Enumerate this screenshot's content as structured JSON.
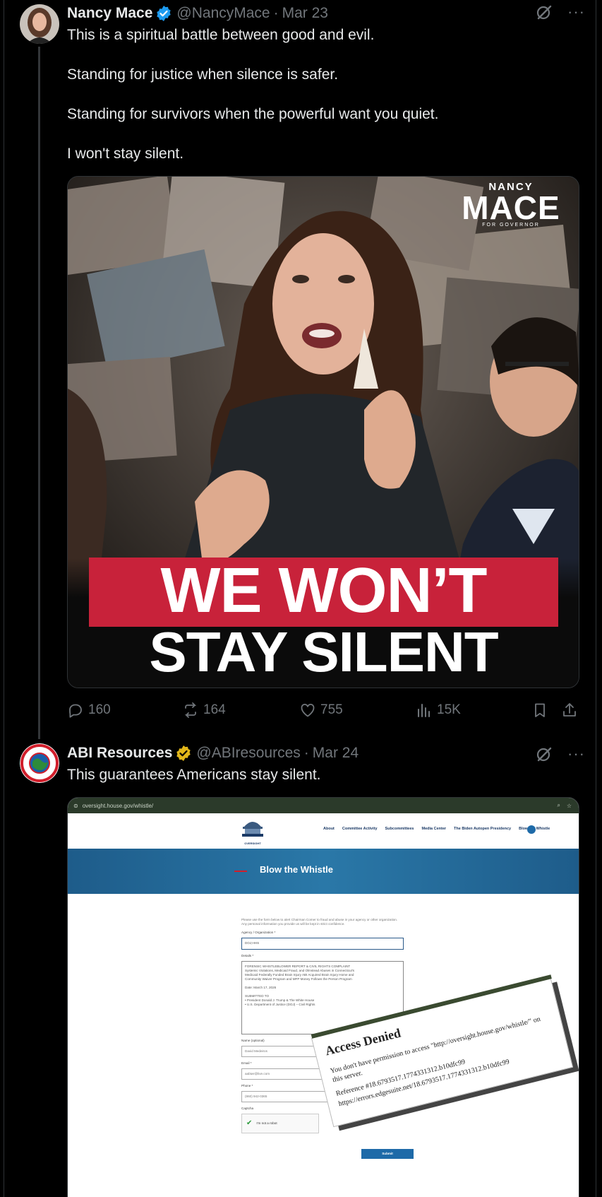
{
  "tweet1": {
    "name": "Nancy Mace",
    "handle": "@NancyMace",
    "dot": "·",
    "date": "Mar 23",
    "text": [
      "This is a spiritual battle between good and evil.",
      "Standing for justice when silence is safer.",
      "Standing for survivors when the powerful want you quiet.",
      "I won't stay silent."
    ],
    "image": {
      "logo_top": "NANCY",
      "logo_main": "MACE",
      "logo_bottom": "FOR GOVERNOR",
      "headline_1": "WE WON’T",
      "headline_2": "STAY SILENT"
    },
    "stats": {
      "replies": "160",
      "reposts": "164",
      "likes": "755",
      "views": "15K"
    }
  },
  "tweet2": {
    "name": "ABI Resources",
    "handle": "@ABIresources",
    "dot": "·",
    "date": "Mar 24",
    "text": "This guarantees Americans stay silent.",
    "screenshot": {
      "url": "oversight.house.gov/whistle/",
      "logo": "OVERSIGHT",
      "nav": [
        "About",
        "Committee Activity",
        "Subcommittees",
        "Media Center",
        "The Biden Autopen Presidency",
        "Blow the Whistle"
      ],
      "banner_title": "Blow the Whistle",
      "intro": "Please use the form below to alert Chairman Comer to fraud and abuse in your agency or other organization. Any personal information you provide us will be kept in strict confidence.",
      "agency_label": "Agency / Organization *",
      "agency_value": "DOJ;HHS",
      "details_label": "Details *",
      "details_lines": [
        "FORENSIC WHISTLEBLOWER REPORT & CIVIL RIGHTS COMPLAINT",
        "Systemic Violations, Medicaid Fraud, and Olmstead Abuses in Connecticut's",
        "Medicaid Federally Funded Brain Injury ABI Acquired Brain Injury Home and",
        "Community Waiver Program and MFP Money Follows the Person Program",
        "",
        "Date: March 17, 2026",
        "",
        "SUBMITTED TO",
        "•    President Donald J. Trump & The White House",
        "•    U.S. Department of Justice (DOJ) – Civil Rights"
      ],
      "name_label": "Name (optional)",
      "name_value": "David Medeiros",
      "email_label": "Email *",
      "email_value": "aabiwr@live.com",
      "phone_label": "Phone *",
      "phone_value": "(860) 942-0365",
      "captcha_label": "Captcha",
      "captcha_text": "I'm not a robot",
      "submit": "Submit",
      "denied_title": "Access Denied",
      "denied_line1": "You don't have permission to access \"http://oversight.house.gov/whistle/\" on this server.",
      "denied_line2": "Reference #18.6793517.1774331312.b10dfc99",
      "denied_line3": "https://errors.edgesuite.net/18.6793517.1774331312.b10dfc99"
    }
  }
}
